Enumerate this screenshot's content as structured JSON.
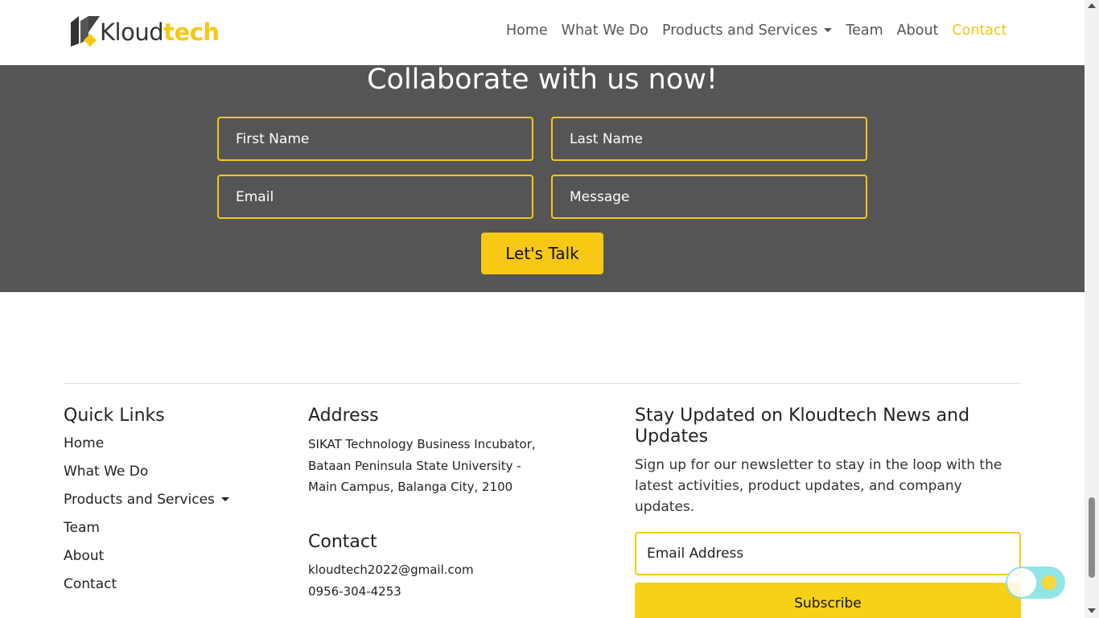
{
  "brand": {
    "name_part1": "Kloud",
    "name_part2": "tech",
    "accent": "#f7c814"
  },
  "nav": {
    "items": [
      {
        "label": "Home",
        "active": false
      },
      {
        "label": "What We Do",
        "active": false
      },
      {
        "label": "Products and Services",
        "active": false,
        "dropdown": true
      },
      {
        "label": "Team",
        "active": false
      },
      {
        "label": "About",
        "active": false
      },
      {
        "label": "Contact",
        "active": true
      }
    ]
  },
  "collab": {
    "title": "Collaborate with us now!",
    "first_name_placeholder": "First Name",
    "last_name_placeholder": "Last Name",
    "email_placeholder": "Email",
    "message_placeholder": "Message",
    "submit_label": "Let's Talk"
  },
  "footer": {
    "quick_links": {
      "title": "Quick Links",
      "items": [
        "Home",
        "What We Do",
        "Products and Services",
        "Team",
        "About",
        "Contact"
      ]
    },
    "address": {
      "title": "Address",
      "text": "SIKAT Technology Business Incubator, Bataan Peninsula State University - Main Campus, Balanga City, 2100"
    },
    "contact": {
      "title": "Contact",
      "email": "kloudtech2022@gmail.com",
      "phone": "0956-304-4253"
    },
    "newsletter": {
      "title": "Stay Updated on Kloudtech News and Updates",
      "description": "Sign up for our newsletter to stay in the loop with the latest activities, product updates, and company updates.",
      "email_placeholder": "Email Address",
      "subscribe_label": "Subscribe"
    }
  },
  "theme_toggle": {
    "icon": "sun-icon"
  }
}
